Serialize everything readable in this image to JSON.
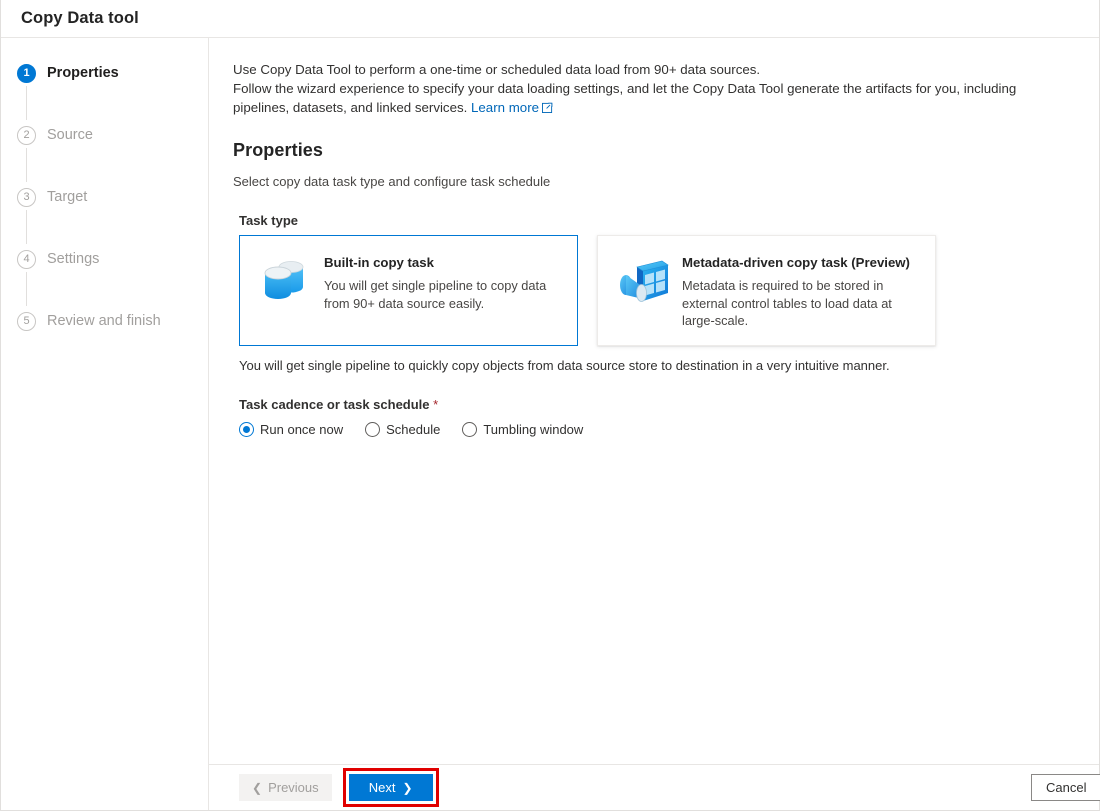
{
  "window": {
    "title": "Copy Data tool"
  },
  "sidebar": {
    "steps": [
      {
        "num": "1",
        "label": "Properties",
        "state": "active"
      },
      {
        "num": "2",
        "label": "Source",
        "state": "idle"
      },
      {
        "num": "3",
        "label": "Target",
        "state": "idle"
      },
      {
        "num": "4",
        "label": "Settings",
        "state": "idle"
      },
      {
        "num": "5",
        "label": "Review and finish",
        "state": "idle"
      }
    ]
  },
  "intro": {
    "line1": "Use Copy Data Tool to perform a one-time or scheduled data load from 90+ data sources.",
    "line2": "Follow the wizard experience to specify your data loading settings, and let the Copy Data Tool generate the artifacts for you, including pipelines, datasets, and linked services.",
    "link_label": "Learn more",
    "link_icon": "external-link-icon"
  },
  "properties": {
    "heading": "Properties",
    "subheading": "Select copy data task type and configure task schedule",
    "task_type_label": "Task type",
    "cards": [
      {
        "title": "Built-in copy task",
        "desc": "You will get single pipeline to copy data from 90+ data source easily.",
        "icon": "database-stack-icon",
        "selected": true
      },
      {
        "title": "Metadata-driven copy task (Preview)",
        "desc": "Metadata is required to be stored in external control tables to load data at large-scale.",
        "icon": "metadata-table-funnel-icon",
        "selected": false
      }
    ],
    "card_note": "You will get single pipeline to quickly copy objects from data source store to destination in a very intuitive manner.",
    "cadence_label": "Task cadence or task schedule",
    "cadence_required_mark": "*",
    "cadence_options": [
      {
        "label": "Run once now",
        "checked": true
      },
      {
        "label": "Schedule",
        "checked": false
      },
      {
        "label": "Tumbling window",
        "checked": false
      }
    ]
  },
  "footer": {
    "previous_label": "Previous",
    "next_label": "Next",
    "cancel_label": "Cancel",
    "previous_icon": "chevron-left-icon",
    "next_icon": "chevron-right-icon",
    "highlight_color": "#e00000",
    "accent_color": "#0078d4"
  }
}
